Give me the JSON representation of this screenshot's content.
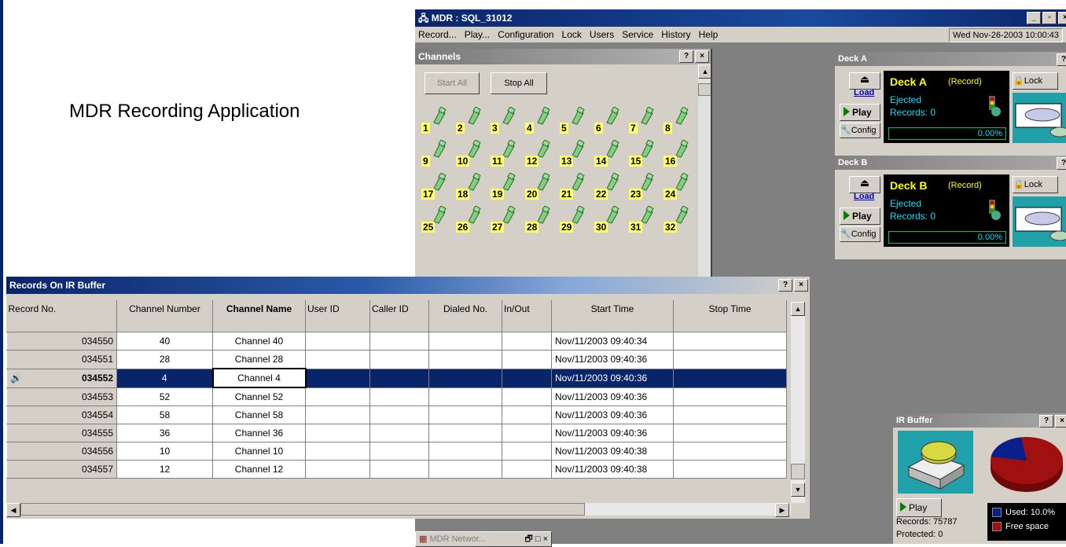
{
  "caption": "MDR Recording Application",
  "main_window": {
    "title": "MDR : SQL_31012",
    "menu": [
      "Record...",
      "Play...",
      "Configuration",
      "Lock",
      "Users",
      "Service",
      "History",
      "Help"
    ],
    "date": "Wed Nov-26-2003 10:00:43"
  },
  "channels": {
    "title": "Channels",
    "start_all": "Start All",
    "stop_all": "Stop All",
    "numbers": [
      "1",
      "2",
      "3",
      "4",
      "5",
      "6",
      "7",
      "8",
      "9",
      "10",
      "11",
      "12",
      "13",
      "14",
      "15",
      "16",
      "17",
      "18",
      "19",
      "20",
      "21",
      "22",
      "23",
      "24",
      "25",
      "26",
      "27",
      "28",
      "29",
      "30",
      "31",
      "32"
    ]
  },
  "deck_a": {
    "title": "Deck A",
    "name": "Deck A",
    "mode": "(Record)",
    "status": "Ejected",
    "records": "Records: 0",
    "percent": "0.00%",
    "load": "Load",
    "play": "Play",
    "config": "Config",
    "lock": "Lock"
  },
  "deck_b": {
    "title": "Deck B",
    "name": "Deck B",
    "mode": "(Record)",
    "status": "Ejected",
    "records": "Records: 0",
    "percent": "0.00%",
    "load": "Load",
    "play": "Play",
    "config": "Config",
    "lock": "Lock"
  },
  "ir_buffer": {
    "title": "IR Buffer",
    "play": "Play",
    "records": "Records: 75787",
    "protected": "Protected: 0",
    "used_label": "Used: 10.0%",
    "free_label": "Free space",
    "used_fraction": 0.1,
    "used_color": "#0a1e8c",
    "free_color": "#a01010"
  },
  "network_button": "MDR Networ...",
  "records": {
    "title": "Records On IR Buffer",
    "columns": [
      "Record No.",
      "Channel Number",
      "Channel Name",
      "User ID",
      "Caller ID",
      "Dialed No.",
      "In/Out",
      "Start Time",
      "Stop Time"
    ],
    "rows": [
      {
        "record_no": "034550",
        "channel_number": "40",
        "channel_name": "Channel 40",
        "start_time": "Nov/11/2003 09:40:34"
      },
      {
        "record_no": "034551",
        "channel_number": "28",
        "channel_name": "Channel 28",
        "start_time": "Nov/11/2003 09:40:36"
      },
      {
        "record_no": "034552",
        "channel_number": "4",
        "channel_name": "Channel 4",
        "start_time": "Nov/11/2003 09:40:36",
        "selected": true
      },
      {
        "record_no": "034553",
        "channel_number": "52",
        "channel_name": "Channel 52",
        "start_time": "Nov/11/2003 09:40:36"
      },
      {
        "record_no": "034554",
        "channel_number": "58",
        "channel_name": "Channel 58",
        "start_time": "Nov/11/2003 09:40:36"
      },
      {
        "record_no": "034555",
        "channel_number": "36",
        "channel_name": "Channel 36",
        "start_time": "Nov/11/2003 09:40:36"
      },
      {
        "record_no": "034556",
        "channel_number": "10",
        "channel_name": "Channel 10",
        "start_time": "Nov/11/2003 09:40:38"
      },
      {
        "record_no": "034557",
        "channel_number": "12",
        "channel_name": "Channel 12",
        "start_time": "Nov/11/2003 09:40:38"
      }
    ]
  }
}
